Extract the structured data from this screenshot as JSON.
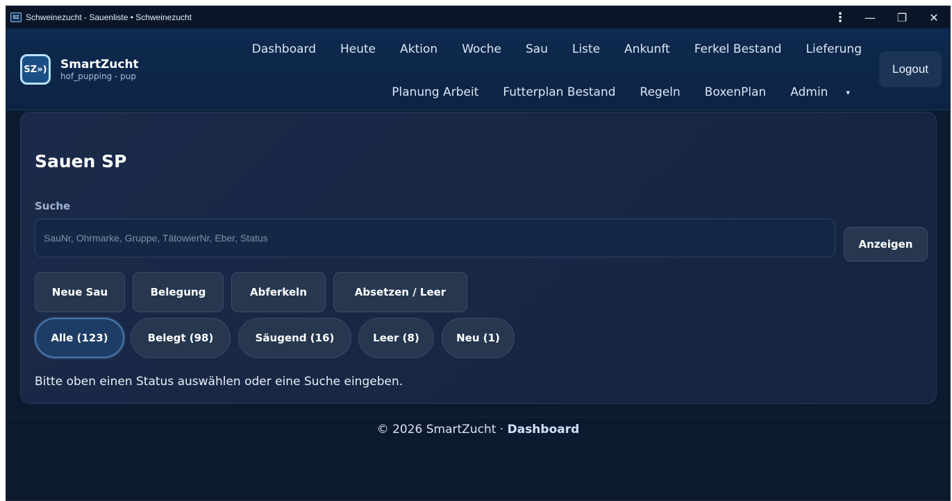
{
  "window": {
    "title": "Schweinezucht - Sauenliste • Schweinezucht",
    "icon_text": "SZ",
    "controls": {
      "menu": "⋮",
      "minimize": "—",
      "restore": "❐",
      "close": "✕"
    }
  },
  "brand": {
    "logo_text": "SZ»)",
    "name": "SmartZucht",
    "subtitle": "hof_pupping - pup"
  },
  "nav": {
    "row1": [
      "Dashboard",
      "Heute",
      "Aktion",
      "Woche",
      "Sau",
      "Liste",
      "Ankunft",
      "Ferkel Bestand",
      "Lieferung"
    ],
    "row2": [
      "Planung Arbeit",
      "Futterplan Bestand",
      "Regeln",
      "BoxenPlan",
      "Admin"
    ],
    "admin_caret": "▾",
    "logout": "Logout"
  },
  "main": {
    "title": "Sauen SP",
    "search_label": "Suche",
    "search_placeholder": "SauNr, Ohrmarke, Gruppe, TätowierNr, Eber, Status",
    "search_value": "",
    "search_button": "Anzeigen",
    "actions": [
      "Neue Sau",
      "Belegung",
      "Abferkeln",
      "Absetzen / Leer"
    ],
    "filters": [
      {
        "label": "Alle (123)",
        "active": true
      },
      {
        "label": "Belegt (98)",
        "active": false
      },
      {
        "label": "Säugend (16)",
        "active": false
      },
      {
        "label": "Leer (8)",
        "active": false
      },
      {
        "label": "Neu (1)",
        "active": false
      }
    ],
    "hint": "Bitte oben einen Status auswählen oder eine Suche eingeben."
  },
  "footer": {
    "text": "© 2026 SmartZucht · ",
    "link": "Dashboard"
  },
  "colors": {
    "background": "#0b1a2e",
    "navbar": "#0e2a4f",
    "card": "#1a2a48",
    "button": "#26374f",
    "active_pill": "#1e3d66"
  }
}
